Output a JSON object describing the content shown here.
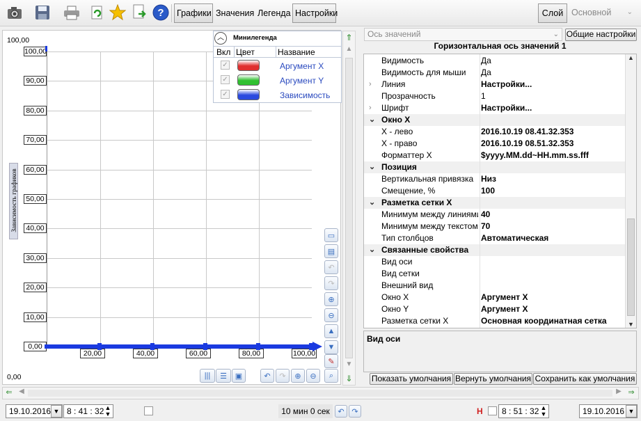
{
  "toolbar": {
    "tabs": [
      "Графики",
      "Значения",
      "Легенда",
      "Настройки"
    ],
    "layer_button": "Слой",
    "layer_value": "Основной"
  },
  "chart": {
    "top_value": "100,00",
    "bottom_value": "0,00",
    "y_axis_title": "Зависимость графиков",
    "chart_data": {
      "type": "line",
      "y_ticks": [
        "100,00",
        "90,00",
        "80,00",
        "70,00",
        "60,00",
        "50,00",
        "40,00",
        "30,00",
        "20,00",
        "10,00",
        "0,00"
      ],
      "x_ticks": [
        "20,00",
        "40,00",
        "60,00",
        "80,00",
        "100,00"
      ],
      "ylim": [
        0,
        100
      ],
      "xlim": [
        0,
        100
      ],
      "grid": true
    }
  },
  "minilegend": {
    "title": "Минилегенда",
    "headers": [
      "Вкл",
      "Цвет",
      "Название"
    ],
    "items": [
      {
        "name": "Аргумент X",
        "color": "#e03030",
        "checked": true
      },
      {
        "name": "Аргумент Y",
        "color": "#30c030",
        "checked": true
      },
      {
        "name": "Зависимость",
        "color": "#2a4adf",
        "checked": true
      }
    ]
  },
  "props": {
    "axis_select": "Ось значений",
    "general_settings": "Общие настройки",
    "header": "Горизонтальная ось значений 1",
    "rows": [
      {
        "name": "Видимость",
        "value": "Да"
      },
      {
        "name": "Видимость для мыши",
        "value": "Да"
      },
      {
        "name": "Линия",
        "value": "Настройки...",
        "expand": "›",
        "bold": true
      },
      {
        "name": "Прозрачность",
        "value": "1"
      },
      {
        "name": "Шрифт",
        "value": "Настройки...",
        "expand": "›",
        "bold": true
      },
      {
        "name": "Окно X",
        "value": "",
        "category": true,
        "expand": "⌄"
      },
      {
        "name": "X - лево",
        "value": "2016.10.19 08.41.32.353",
        "bold": true
      },
      {
        "name": "X - право",
        "value": "2016.10.19 08.51.32.353",
        "bold": true
      },
      {
        "name": "Форматтер X",
        "value": "$yyyy.MM.dd~HH.mm.ss.fff",
        "bold": true
      },
      {
        "name": "Позиция",
        "value": "",
        "category": true,
        "expand": "⌄"
      },
      {
        "name": "Вертикальная привязка",
        "value": "Низ",
        "bold": true
      },
      {
        "name": "Смещение, %",
        "value": "100",
        "bold": true
      },
      {
        "name": "Разметка сетки X",
        "value": "",
        "category": true,
        "expand": "⌄"
      },
      {
        "name": "Минимум между линиями",
        "value": "40",
        "bold": true
      },
      {
        "name": "Минимум между текстом",
        "value": "70",
        "bold": true
      },
      {
        "name": "Тип столбцов",
        "value": "Автоматическая",
        "bold": true
      },
      {
        "name": "Связанные свойства",
        "value": "",
        "category": true,
        "expand": "⌄"
      },
      {
        "name": "Вид оси",
        "value": ""
      },
      {
        "name": "Вид сетки",
        "value": ""
      },
      {
        "name": "Внешний вид",
        "value": ""
      },
      {
        "name": "Окно X",
        "value": "Аргумент X",
        "bold": true
      },
      {
        "name": "Окно Y",
        "value": "Аргумент X",
        "bold": true
      },
      {
        "name": "Разметка сетки X",
        "value": "Основная координатная сетка",
        "bold": true
      }
    ],
    "description": "Вид оси",
    "buttons": [
      "Показать умолчания",
      "Вернуть умолчания",
      "Сохранить как умолчания"
    ]
  },
  "status": {
    "date_left": "19.10.2016",
    "time_left": "8 : 41 : 32",
    "span": "10 мин 0 сек",
    "h_label": "H",
    "time_right": "8 : 51 : 32",
    "date_right": "19.10.2016"
  }
}
